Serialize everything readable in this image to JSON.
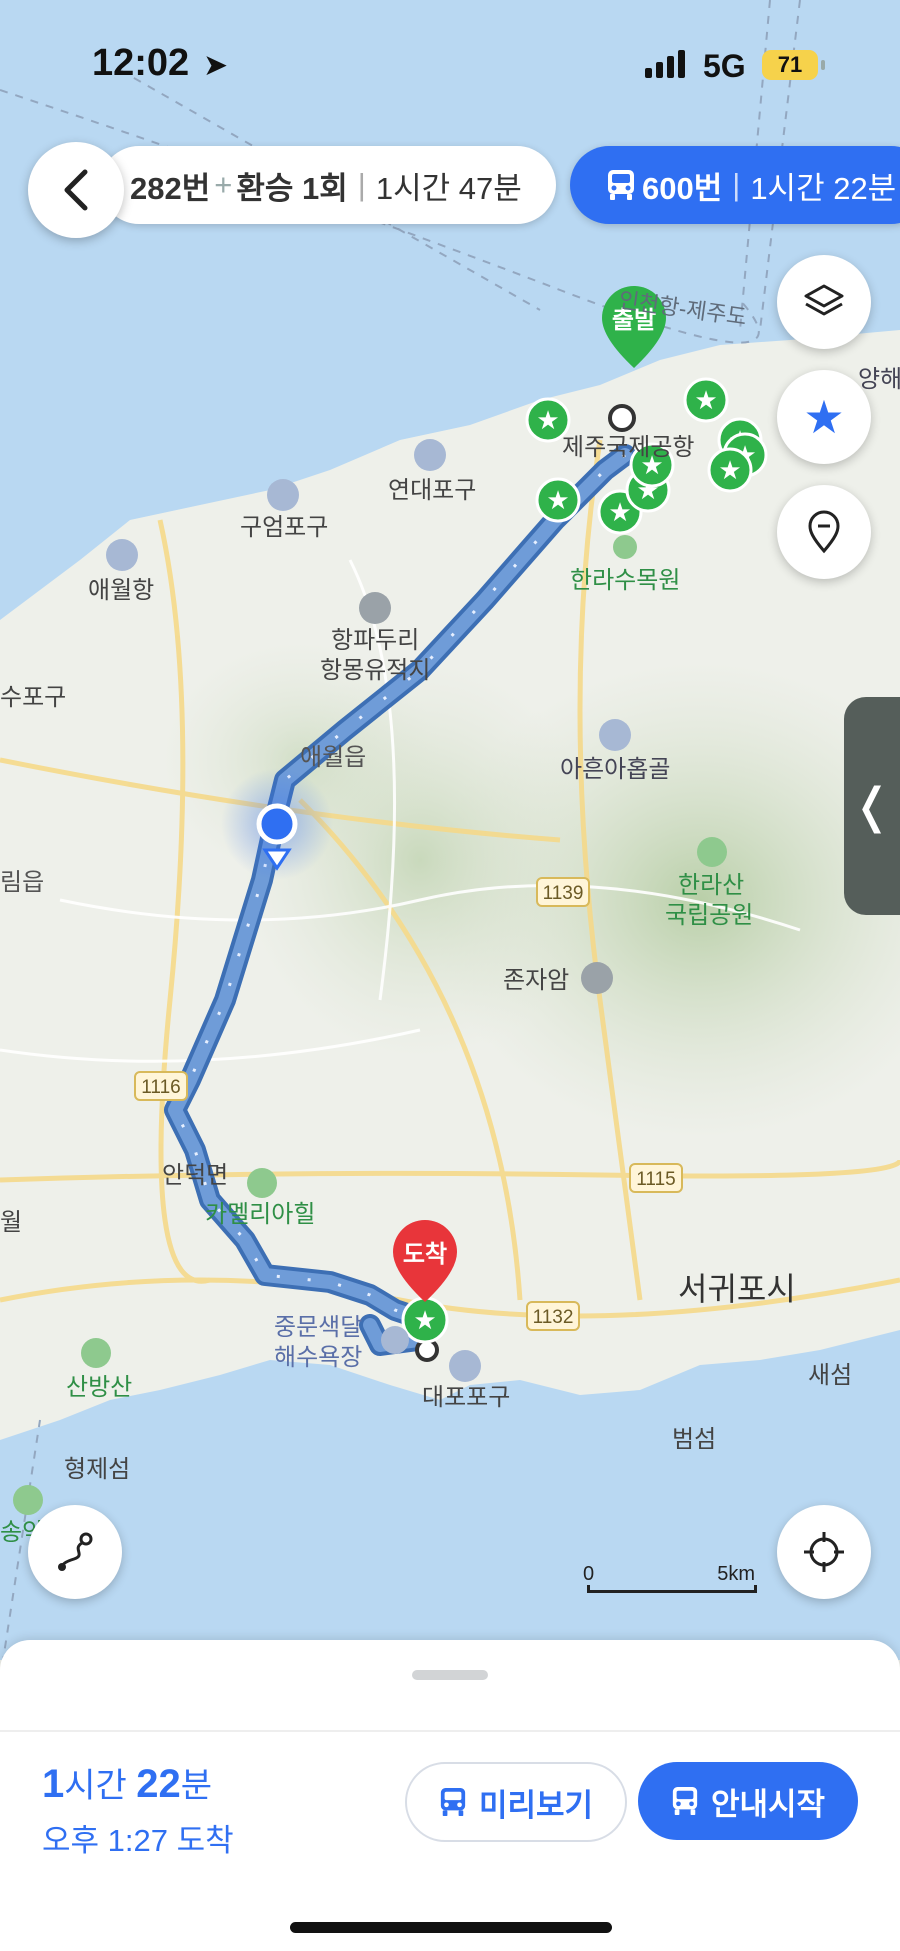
{
  "status_bar": {
    "time": "12:02",
    "network": "5G",
    "battery": "71"
  },
  "route_options": {
    "option1": {
      "bus": "282번",
      "transfer": "환승 1회",
      "duration": "1시간 47분"
    },
    "option2": {
      "bus": "600번",
      "duration": "1시간 22분"
    }
  },
  "markers": {
    "start": "출발",
    "end": "도착"
  },
  "map_labels": [
    {
      "text": "인천항-제주도"
    },
    {
      "text": "양해"
    },
    {
      "text": "제주국제공항"
    },
    {
      "text": "연대포구"
    },
    {
      "text": "구엄포구"
    },
    {
      "text": "애월항"
    },
    {
      "text": "한라수목원"
    },
    {
      "text": "항파두리"
    },
    {
      "text": "항몽유적지"
    },
    {
      "text": "수포구"
    },
    {
      "text": "애월읍"
    },
    {
      "text": "아흔아홉골"
    },
    {
      "text": "림읍"
    },
    {
      "text": "1139"
    },
    {
      "text": "한라산"
    },
    {
      "text": "국립공원"
    },
    {
      "text": "존자암"
    },
    {
      "text": "1116"
    },
    {
      "text": "안덕면"
    },
    {
      "text": "카멜리아힐"
    },
    {
      "text": "1115"
    },
    {
      "text": "월"
    },
    {
      "text": "서귀포시"
    },
    {
      "text": "1132"
    },
    {
      "text": "중문색달"
    },
    {
      "text": "해수욕장"
    },
    {
      "text": "산방산"
    },
    {
      "text": "대포포구"
    },
    {
      "text": "새섬"
    },
    {
      "text": "범섬"
    },
    {
      "text": "형제섬"
    },
    {
      "text": "송악"
    }
  ],
  "scale": {
    "zero": "0",
    "distance": "5km"
  },
  "bottom_sheet": {
    "duration_hours": "1",
    "hours_unit": "시간",
    "duration_minutes": "22",
    "minutes_unit": "분",
    "arrival": "오후 1:27 도착",
    "preview_label": "미리보기",
    "start_label": "안내시작"
  },
  "colors": {
    "accent": "#2f6ff2",
    "route": "#4a7fc8",
    "sea": "#b9d8f2",
    "land": "#eef0ea",
    "favorite": "#2fb24a",
    "end_marker": "#e8353a"
  },
  "icons": [
    "back-icon",
    "bus-icon",
    "layers-icon",
    "star-icon",
    "pin-icon",
    "route-icon",
    "locate-icon",
    "collapse-icon",
    "navigation-arrow-icon"
  ]
}
